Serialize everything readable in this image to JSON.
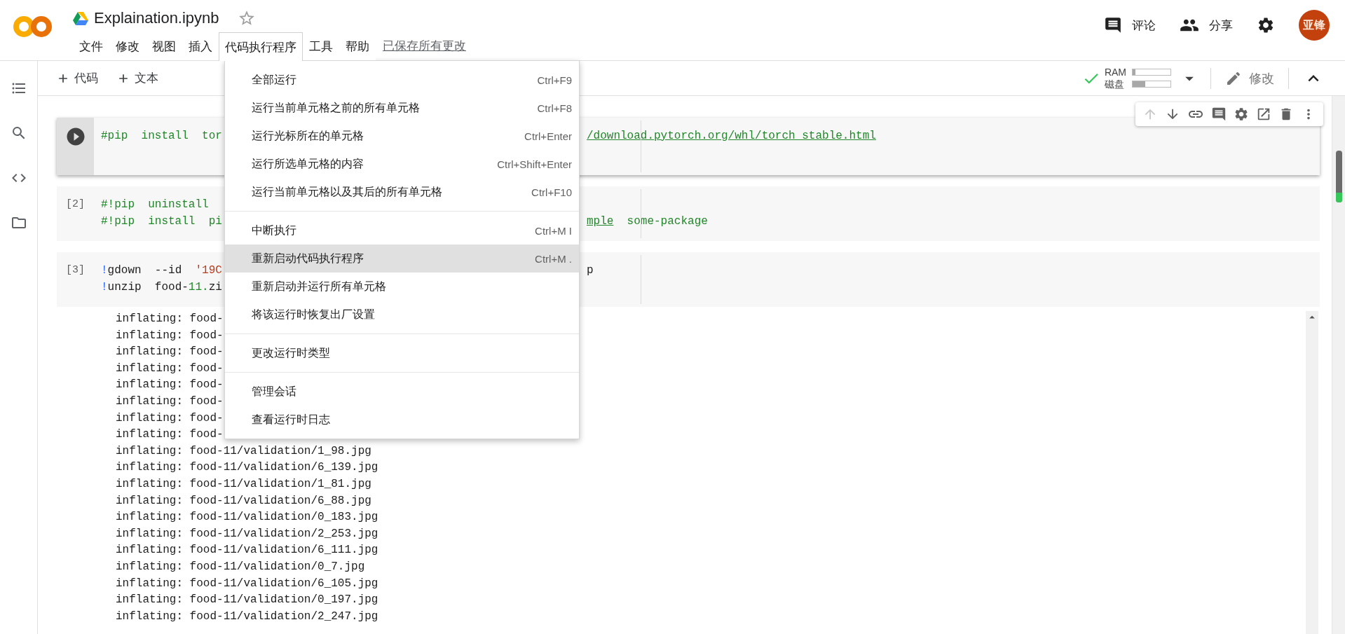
{
  "document": {
    "title": "Explaination.ipynb",
    "starred": false
  },
  "menu_bar": [
    {
      "label": "文件",
      "selected": false
    },
    {
      "label": "修改",
      "selected": false
    },
    {
      "label": "视图",
      "selected": false
    },
    {
      "label": "插入",
      "selected": false
    },
    {
      "label": "代码执行程序",
      "selected": true
    },
    {
      "label": "工具",
      "selected": false
    },
    {
      "label": "帮助",
      "selected": false
    }
  ],
  "save_status": "已保存所有更改",
  "header_actions": [
    {
      "kind": "comment",
      "label": "评论"
    },
    {
      "kind": "share",
      "label": "分享"
    }
  ],
  "avatar": {
    "initials": "亚锋"
  },
  "toolbar": {
    "insert": [
      {
        "label": "代码"
      },
      {
        "label": "文本"
      }
    ],
    "connected": true,
    "resources": [
      {
        "label": "RAM",
        "level": 0.08
      },
      {
        "label": "磁盘",
        "level": 0.33
      }
    ],
    "edit": "修改"
  },
  "cell_toolbar": {
    "move_up_disabled": true
  },
  "cells": [
    {
      "focused": true,
      "lines": [
        {
          "left": [
            {
              "kind": "comment",
              "text": "#pip  install  tor"
            }
          ],
          "right": [
            {
              "kind": "link",
              "text": "/download.pytorch.org/whl/torch_stable.html"
            }
          ]
        }
      ]
    },
    {
      "focused": false,
      "prompt": "[2]",
      "lines": [
        {
          "left": [
            {
              "kind": "comment",
              "text": "#!pip  uninstall"
            }
          ]
        },
        {
          "left": [
            {
              "kind": "comment",
              "text": "#!pip  install  pi"
            }
          ],
          "right": [
            {
              "kind": "link",
              "text": "mple"
            },
            {
              "kind": "comment",
              "text": "  some-package"
            }
          ]
        }
      ]
    },
    {
      "focused": false,
      "prompt": "[3]",
      "lines": [
        {
          "left": [
            {
              "kind": "bang",
              "text": "!"
            },
            {
              "kind": "plain",
              "text": "gdown  --id  "
            },
            {
              "kind": "string",
              "text": "'19C"
            }
          ],
          "right": [
            {
              "kind": "plain",
              "text": "p"
            }
          ]
        },
        {
          "left": [
            {
              "kind": "bang",
              "text": "!"
            },
            {
              "kind": "plain",
              "text": "unzip  food-"
            },
            {
              "kind": "number",
              "text": "11."
            },
            {
              "kind": "plain",
              "text": "zi"
            }
          ]
        }
      ]
    }
  ],
  "output": {
    "lines": [
      "inflating: food-",
      "inflating: food-",
      "inflating: food-",
      "inflating: food-",
      "inflating: food-",
      "inflating: food-",
      "inflating: food-",
      "inflating: food-",
      "inflating: food-11/validation/1_98.jpg",
      "inflating: food-11/validation/6_139.jpg",
      "inflating: food-11/validation/1_81.jpg",
      "inflating: food-11/validation/6_88.jpg",
      "inflating: food-11/validation/0_183.jpg",
      "inflating: food-11/validation/2_253.jpg",
      "inflating: food-11/validation/6_111.jpg",
      "inflating: food-11/validation/0_7.jpg",
      "inflating: food-11/validation/6_105.jpg",
      "inflating: food-11/validation/0_197.jpg",
      "inflating: food-11/validation/2_247.jpg"
    ]
  },
  "runtime_menu": {
    "groups": [
      [
        {
          "label": "全部运行",
          "shortcut": "Ctrl+F9",
          "selected": false
        },
        {
          "label": "运行当前单元格之前的所有单元格",
          "shortcut": "Ctrl+F8",
          "selected": false
        },
        {
          "label": "运行光标所在的单元格",
          "shortcut": "Ctrl+Enter",
          "selected": false
        },
        {
          "label": "运行所选单元格的内容",
          "shortcut": "Ctrl+Shift+Enter",
          "selected": false
        },
        {
          "label": "运行当前单元格以及其后的所有单元格",
          "shortcut": "Ctrl+F10",
          "selected": false
        }
      ],
      [
        {
          "label": "中断执行",
          "shortcut": "Ctrl+M I",
          "selected": false
        },
        {
          "label": "重新启动代码执行程序",
          "shortcut": "Ctrl+M .",
          "selected": true
        },
        {
          "label": "重新启动并运行所有单元格",
          "selected": false
        },
        {
          "label": "将该运行时恢复出厂设置",
          "selected": false
        }
      ],
      [
        {
          "label": "更改运行时类型",
          "selected": false
        }
      ],
      [
        {
          "label": "管理会话",
          "selected": false
        },
        {
          "label": "查看运行时日志",
          "selected": false
        }
      ]
    ]
  }
}
